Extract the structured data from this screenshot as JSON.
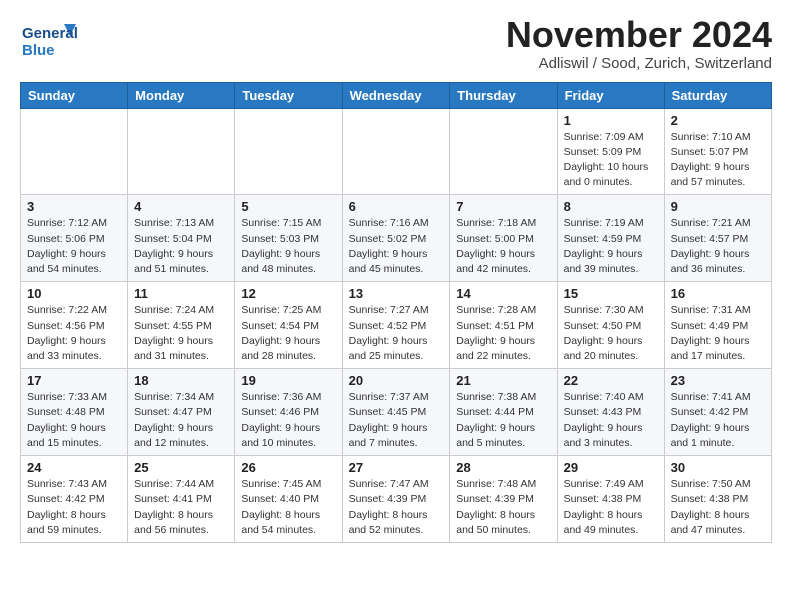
{
  "header": {
    "logo_line1": "General",
    "logo_line2": "Blue",
    "month_title": "November 2024",
    "location": "Adliswil / Sood, Zurich, Switzerland"
  },
  "days_of_week": [
    "Sunday",
    "Monday",
    "Tuesday",
    "Wednesday",
    "Thursday",
    "Friday",
    "Saturday"
  ],
  "weeks": [
    [
      {
        "day": "",
        "info": ""
      },
      {
        "day": "",
        "info": ""
      },
      {
        "day": "",
        "info": ""
      },
      {
        "day": "",
        "info": ""
      },
      {
        "day": "",
        "info": ""
      },
      {
        "day": "1",
        "info": "Sunrise: 7:09 AM\nSunset: 5:09 PM\nDaylight: 10 hours\nand 0 minutes."
      },
      {
        "day": "2",
        "info": "Sunrise: 7:10 AM\nSunset: 5:07 PM\nDaylight: 9 hours\nand 57 minutes."
      }
    ],
    [
      {
        "day": "3",
        "info": "Sunrise: 7:12 AM\nSunset: 5:06 PM\nDaylight: 9 hours\nand 54 minutes."
      },
      {
        "day": "4",
        "info": "Sunrise: 7:13 AM\nSunset: 5:04 PM\nDaylight: 9 hours\nand 51 minutes."
      },
      {
        "day": "5",
        "info": "Sunrise: 7:15 AM\nSunset: 5:03 PM\nDaylight: 9 hours\nand 48 minutes."
      },
      {
        "day": "6",
        "info": "Sunrise: 7:16 AM\nSunset: 5:02 PM\nDaylight: 9 hours\nand 45 minutes."
      },
      {
        "day": "7",
        "info": "Sunrise: 7:18 AM\nSunset: 5:00 PM\nDaylight: 9 hours\nand 42 minutes."
      },
      {
        "day": "8",
        "info": "Sunrise: 7:19 AM\nSunset: 4:59 PM\nDaylight: 9 hours\nand 39 minutes."
      },
      {
        "day": "9",
        "info": "Sunrise: 7:21 AM\nSunset: 4:57 PM\nDaylight: 9 hours\nand 36 minutes."
      }
    ],
    [
      {
        "day": "10",
        "info": "Sunrise: 7:22 AM\nSunset: 4:56 PM\nDaylight: 9 hours\nand 33 minutes."
      },
      {
        "day": "11",
        "info": "Sunrise: 7:24 AM\nSunset: 4:55 PM\nDaylight: 9 hours\nand 31 minutes."
      },
      {
        "day": "12",
        "info": "Sunrise: 7:25 AM\nSunset: 4:54 PM\nDaylight: 9 hours\nand 28 minutes."
      },
      {
        "day": "13",
        "info": "Sunrise: 7:27 AM\nSunset: 4:52 PM\nDaylight: 9 hours\nand 25 minutes."
      },
      {
        "day": "14",
        "info": "Sunrise: 7:28 AM\nSunset: 4:51 PM\nDaylight: 9 hours\nand 22 minutes."
      },
      {
        "day": "15",
        "info": "Sunrise: 7:30 AM\nSunset: 4:50 PM\nDaylight: 9 hours\nand 20 minutes."
      },
      {
        "day": "16",
        "info": "Sunrise: 7:31 AM\nSunset: 4:49 PM\nDaylight: 9 hours\nand 17 minutes."
      }
    ],
    [
      {
        "day": "17",
        "info": "Sunrise: 7:33 AM\nSunset: 4:48 PM\nDaylight: 9 hours\nand 15 minutes."
      },
      {
        "day": "18",
        "info": "Sunrise: 7:34 AM\nSunset: 4:47 PM\nDaylight: 9 hours\nand 12 minutes."
      },
      {
        "day": "19",
        "info": "Sunrise: 7:36 AM\nSunset: 4:46 PM\nDaylight: 9 hours\nand 10 minutes."
      },
      {
        "day": "20",
        "info": "Sunrise: 7:37 AM\nSunset: 4:45 PM\nDaylight: 9 hours\nand 7 minutes."
      },
      {
        "day": "21",
        "info": "Sunrise: 7:38 AM\nSunset: 4:44 PM\nDaylight: 9 hours\nand 5 minutes."
      },
      {
        "day": "22",
        "info": "Sunrise: 7:40 AM\nSunset: 4:43 PM\nDaylight: 9 hours\nand 3 minutes."
      },
      {
        "day": "23",
        "info": "Sunrise: 7:41 AM\nSunset: 4:42 PM\nDaylight: 9 hours\nand 1 minute."
      }
    ],
    [
      {
        "day": "24",
        "info": "Sunrise: 7:43 AM\nSunset: 4:42 PM\nDaylight: 8 hours\nand 59 minutes."
      },
      {
        "day": "25",
        "info": "Sunrise: 7:44 AM\nSunset: 4:41 PM\nDaylight: 8 hours\nand 56 minutes."
      },
      {
        "day": "26",
        "info": "Sunrise: 7:45 AM\nSunset: 4:40 PM\nDaylight: 8 hours\nand 54 minutes."
      },
      {
        "day": "27",
        "info": "Sunrise: 7:47 AM\nSunset: 4:39 PM\nDaylight: 8 hours\nand 52 minutes."
      },
      {
        "day": "28",
        "info": "Sunrise: 7:48 AM\nSunset: 4:39 PM\nDaylight: 8 hours\nand 50 minutes."
      },
      {
        "day": "29",
        "info": "Sunrise: 7:49 AM\nSunset: 4:38 PM\nDaylight: 8 hours\nand 49 minutes."
      },
      {
        "day": "30",
        "info": "Sunrise: 7:50 AM\nSunset: 4:38 PM\nDaylight: 8 hours\nand 47 minutes."
      }
    ]
  ]
}
